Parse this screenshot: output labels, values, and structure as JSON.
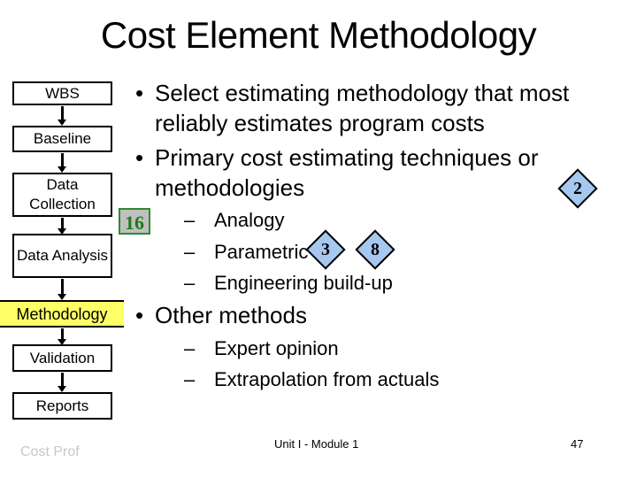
{
  "slide": {
    "title": "Cost Element Methodology",
    "flow": [
      {
        "label": "WBS",
        "highlighted": false
      },
      {
        "label": "Baseline",
        "highlighted": false
      },
      {
        "label": "Data Collection",
        "highlighted": false
      },
      {
        "label": "Data Analysis",
        "highlighted": false
      },
      {
        "label": "Methodology",
        "highlighted": true
      },
      {
        "label": "Validation",
        "highlighted": false
      },
      {
        "label": "Reports",
        "highlighted": false
      }
    ],
    "bullets": [
      {
        "text": "Select estimating methodology that most reliably estimates program costs"
      },
      {
        "text": "Primary cost estimating techniques or methodologies",
        "subitems": [
          "Analogy",
          "Parametric",
          "Engineering build-up"
        ]
      },
      {
        "text": "Other methods",
        "subitems": [
          "Expert opinion",
          "Extrapolation from actuals"
        ]
      }
    ],
    "badges": {
      "square": "16",
      "diamond_1": "2",
      "diamond_2": "3",
      "diamond_3": "8"
    },
    "colors": {
      "highlight": "#ffff66",
      "diamond_fill": "#a6c8f0",
      "square_fill": "#c0c0c0",
      "square_border": "#2e8b2e"
    }
  },
  "footer": {
    "left": "Cost Prof",
    "center": "Unit I - Module 1",
    "page": "47"
  }
}
